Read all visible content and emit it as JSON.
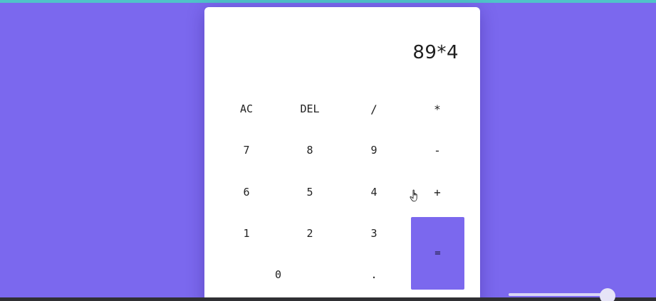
{
  "calculator": {
    "display": "89*4",
    "keys": {
      "ac": "AC",
      "del": "DEL",
      "divide": "/",
      "multiply": "*",
      "seven": "7",
      "eight": "8",
      "nine": "9",
      "minus": "-",
      "six": "6",
      "five": "5",
      "four": "4",
      "plus": "+",
      "one": "1",
      "two": "2",
      "three": "3",
      "equals": "=",
      "zero": "0",
      "decimal": "."
    }
  },
  "colors": {
    "background": "#7b68ee",
    "accent": "#7b68ee",
    "top_strip": "#4fc3c8",
    "panel": "#ffffff"
  },
  "icons": {
    "cursor": "hand-pointer-icon"
  }
}
